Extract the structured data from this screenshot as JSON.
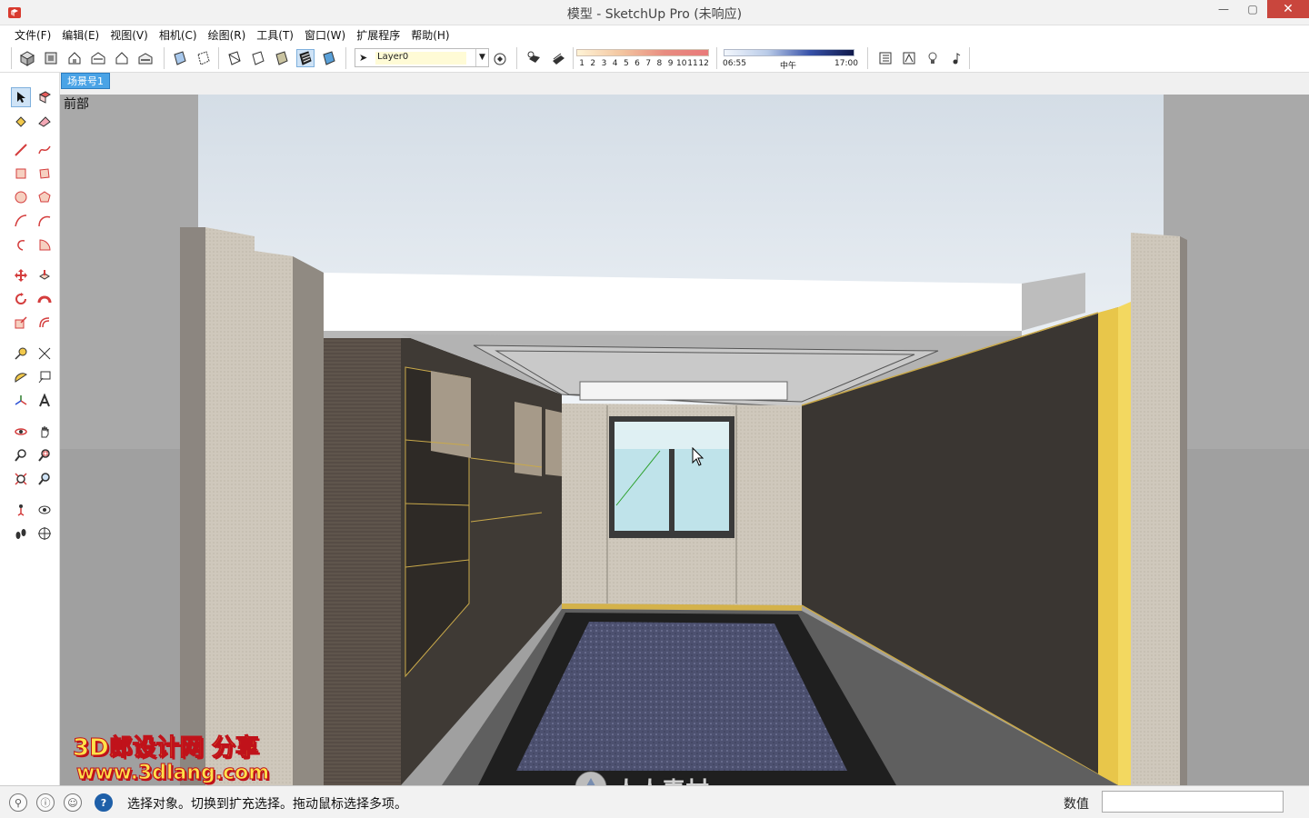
{
  "window": {
    "title": "模型 - SketchUp Pro (未响应)",
    "minimize": "—",
    "restore": "▢",
    "close": "✕"
  },
  "menu": [
    "文件(F)",
    "编辑(E)",
    "视图(V)",
    "相机(C)",
    "绘图(R)",
    "工具(T)",
    "窗口(W)",
    "扩展程序",
    "帮助(H)"
  ],
  "toolbar": {
    "layer_name": "Layer0",
    "months": [
      "1",
      "2",
      "3",
      "4",
      "5",
      "6",
      "7",
      "8",
      "9",
      "10",
      "11",
      "12"
    ],
    "time_start": "06:55",
    "time_mid": "中午",
    "time_end": "17:00"
  },
  "scene_tab": "场景号1",
  "viewport": {
    "view_name": "前部"
  },
  "status": {
    "message": "选择对象。切换到扩充选择。拖动鼠标选择多项。",
    "measure_label": "数值",
    "measure_value": ""
  },
  "watermarks": {
    "line1": "3D郎设计网 分享",
    "line2": "www.3dlang.com",
    "line3": "人人素材"
  },
  "colors": {
    "accent": "#4aa3e6",
    "close_button": "#c9463d",
    "wall_dark": "#3a3632",
    "gold_trim": "#e8c64a",
    "sky": "#e8f0f6"
  }
}
